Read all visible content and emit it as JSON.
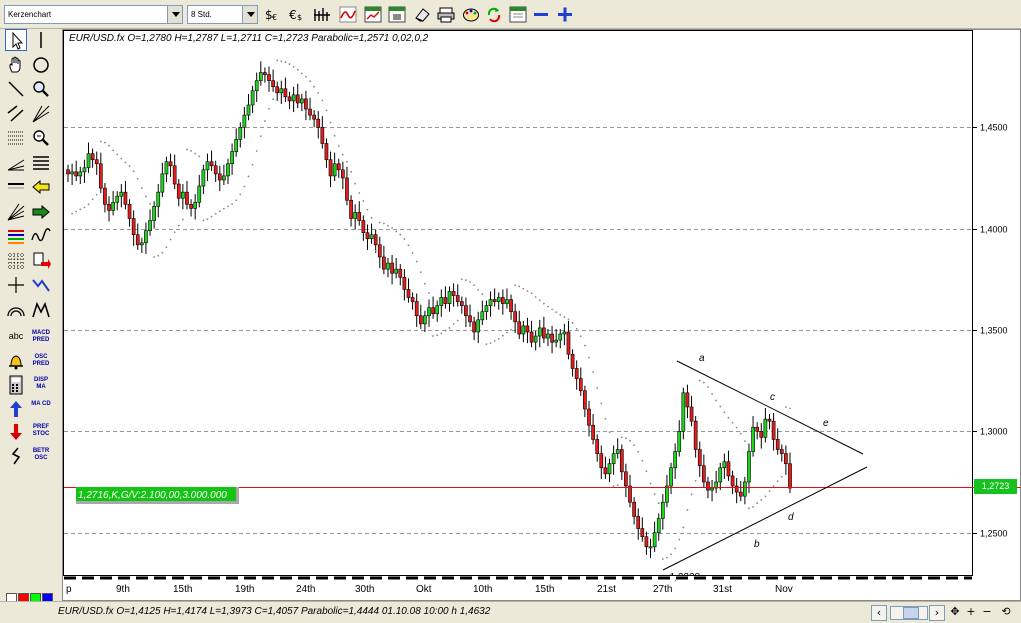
{
  "toolbar": {
    "chart_type_value": "Kerzenchart",
    "period_value": "8 Std.",
    "icons": [
      "dollar-euro-icon",
      "euro-icon",
      "grid-bars-icon",
      "wave-chart-icon",
      "chart-window-icon",
      "chart-lock-icon",
      "eraser-icon",
      "printer-icon",
      "palette-icon",
      "refresh-chart-icon",
      "window-icon",
      "zoom-out-icon",
      "zoom-in-icon"
    ]
  },
  "palette": {
    "tools": [
      {
        "name": "pointer-tool",
        "icon": "cursor-arrow-icon",
        "selected": true
      },
      {
        "name": "vertical-line-tool",
        "icon": "vertical-line-icon"
      },
      {
        "name": "hand-tool",
        "icon": "hand-icon"
      },
      {
        "name": "circle-tool",
        "icon": "circle-icon"
      },
      {
        "name": "trend-line-tool",
        "icon": "diagonal-line-icon"
      },
      {
        "name": "magnifier-tool",
        "icon": "magnifier-icon"
      },
      {
        "name": "parallel-lines-tool",
        "icon": "parallel-lines-icon"
      },
      {
        "name": "fibonacci-tool",
        "icon": "fibonacci-icon"
      },
      {
        "name": "dotted-grid-tool",
        "icon": "dotted-grid-icon"
      },
      {
        "name": "zoom-box-tool",
        "icon": "zoom-box-icon"
      },
      {
        "name": "angle-tool",
        "icon": "angle-icon"
      },
      {
        "name": "horizontal-lines-tool",
        "icon": "horizontal-lines-icon"
      },
      {
        "name": "horizontal-line-tool",
        "icon": "horizontal-line-icon"
      },
      {
        "name": "arrow-left-tool",
        "icon": "arrow-left-icon"
      },
      {
        "name": "fan-tool",
        "icon": "fan-icon"
      },
      {
        "name": "arrow-right-tool",
        "icon": "arrow-right-icon"
      },
      {
        "name": "color-bars-tool",
        "icon": "color-bars-icon"
      },
      {
        "name": "wave-tool",
        "icon": "wave-icon"
      },
      {
        "name": "dot-grid-tool",
        "icon": "dot-grid-icon"
      },
      {
        "name": "page-arrow-tool",
        "icon": "page-arrow-icon"
      },
      {
        "name": "crosshair-tool",
        "icon": "crosshair-icon"
      },
      {
        "name": "zigzag-tool",
        "icon": "zigzag-icon"
      },
      {
        "name": "arc-tool",
        "icon": "arc-icon"
      },
      {
        "name": "elliott-tool",
        "icon": "elliott-wave-icon"
      }
    ],
    "text_tools": [
      {
        "name": "text-tool",
        "label": "abc"
      },
      {
        "name": "macd-pred-tool",
        "label": "MACD PRED"
      },
      {
        "name": "alarm-tool",
        "icon": "bell-icon"
      },
      {
        "name": "osc-pred-tool",
        "label": "OSC PRED"
      },
      {
        "name": "calculator-tool",
        "icon": "calculator-icon"
      },
      {
        "name": "disp-ma-tool",
        "label": "DISP MA"
      },
      {
        "name": "buy-arrow-tool",
        "icon": "up-arrow-icon"
      },
      {
        "name": "macd-tool",
        "label": "MA CD"
      },
      {
        "name": "sell-arrow-tool",
        "icon": "down-arrow-icon"
      },
      {
        "name": "pref-stoc-tool",
        "label": "PREF STOC"
      },
      {
        "name": "squiggle-tool",
        "icon": "squiggle-icon"
      },
      {
        "name": "betr-osc-tool",
        "label": "BETR OSC"
      }
    ],
    "colors": [
      "#ffffff",
      "#ff0000",
      "#00ff00",
      "#0000ff",
      "#000000",
      "#800000",
      "#008000",
      "#000080"
    ]
  },
  "chart": {
    "info_line": "EUR/USD.fx  O=1,2780 H=1,2787 L=1,2711 C=1,2723    Parabolic=1,2571  0,02,0,2",
    "price_tag": "1,2723",
    "order_label": "1,2716,K,G/V:2.100,00,3.000.000",
    "low_label": "1,2328",
    "annotations": [
      "a",
      "b",
      "c",
      "d",
      "e"
    ]
  },
  "chart_data": {
    "type": "candlestick",
    "symbol": "EUR/USD.fx",
    "y_ticks": [
      "1,4500",
      "1,4000",
      "1,3500",
      "1,3000",
      "1,2500"
    ],
    "y_values": [
      1.45,
      1.4,
      1.35,
      1.3,
      1.25
    ],
    "ylim": [
      1.2291,
      1.498
    ],
    "x_ticks": [
      "p",
      "9th",
      "15th",
      "19th",
      "24th",
      "30th",
      "Okt",
      "10th",
      "15th",
      "21st",
      "27th",
      "31st",
      "Nov"
    ],
    "grid": "horizontal-dashed",
    "current_price": 1.2723,
    "order_price": 1.2716,
    "indicator": "Parabolic SAR 0,02,0,2",
    "closes": [
      1.427,
      1.428,
      1.426,
      1.428,
      1.43,
      1.437,
      1.434,
      1.432,
      1.42,
      1.412,
      1.409,
      1.413,
      1.416,
      1.418,
      1.412,
      1.405,
      1.397,
      1.392,
      1.393,
      1.399,
      1.404,
      1.411,
      1.418,
      1.427,
      1.433,
      1.431,
      1.422,
      1.415,
      1.418,
      1.412,
      1.41,
      1.413,
      1.421,
      1.429,
      1.433,
      1.431,
      1.427,
      1.424,
      1.426,
      1.432,
      1.438,
      1.444,
      1.45,
      1.456,
      1.461,
      1.468,
      1.473,
      1.477,
      1.476,
      1.473,
      1.47,
      1.467,
      1.469,
      1.465,
      1.463,
      1.466,
      1.462,
      1.464,
      1.459,
      1.456,
      1.454,
      1.45,
      1.442,
      1.434,
      1.426,
      1.432,
      1.429,
      1.425,
      1.414,
      1.405,
      1.408,
      1.404,
      1.398,
      1.395,
      1.397,
      1.392,
      1.386,
      1.38,
      1.383,
      1.378,
      1.38,
      1.376,
      1.37,
      1.366,
      1.364,
      1.357,
      1.353,
      1.357,
      1.361,
      1.358,
      1.362,
      1.366,
      1.363,
      1.369,
      1.367,
      1.364,
      1.362,
      1.357,
      1.354,
      1.349,
      1.355,
      1.359,
      1.362,
      1.365,
      1.364,
      1.366,
      1.363,
      1.365,
      1.359,
      1.354,
      1.348,
      1.352,
      1.349,
      1.344,
      1.347,
      1.351,
      1.346,
      1.348,
      1.344,
      1.345,
      1.348,
      1.349,
      1.338,
      1.331,
      1.326,
      1.32,
      1.311,
      1.303,
      1.296,
      1.289,
      1.282,
      1.279,
      1.284,
      1.289,
      1.291,
      1.28,
      1.273,
      1.265,
      1.258,
      1.252,
      1.248,
      1.243,
      1.243,
      1.25,
      1.257,
      1.265,
      1.273,
      1.282,
      1.29,
      1.3,
      1.319,
      1.312,
      1.305,
      1.291,
      1.283,
      1.275,
      1.271,
      1.272,
      1.275,
      1.282,
      1.285,
      1.278,
      1.273,
      1.27,
      1.268,
      1.275,
      1.29,
      1.302,
      1.3,
      1.297,
      1.306,
      1.305,
      1.296,
      1.291,
      1.289,
      1.284,
      1.272
    ]
  },
  "status": {
    "text": "EUR/USD.fx  O=1,4125 H=1,4174 L=1,3973 C=1,4057    Parabolic=1,4444  01.10.08 10:00 h 1,4632"
  }
}
